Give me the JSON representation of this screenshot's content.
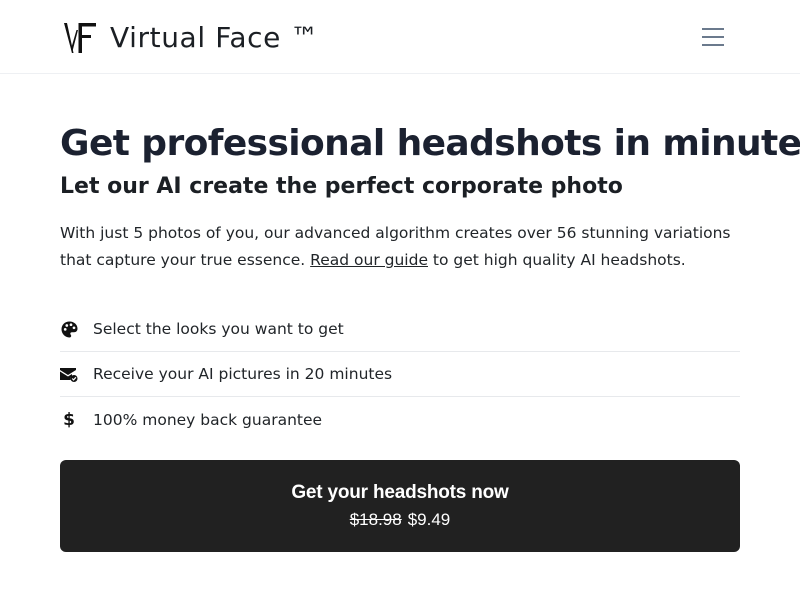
{
  "header": {
    "brand_name": "Virtual Face ™",
    "menu_icon": "hamburger-menu-icon",
    "logo_icon": "vf-logo-icon"
  },
  "main": {
    "headline": "Get professional headshots in minutes",
    "subheadline": "Let our AI create the perfect corporate photo",
    "lead_text_1": "With just 5 photos of you, our advanced algorithm creates over 56 stunning variations that capture your true essence.",
    "guide_link": "Read our guide",
    "lead_text_2": "to get high quality AI headshots.",
    "features": [
      {
        "icon": "palette-icon",
        "label": "Select the looks you want to get"
      },
      {
        "icon": "envelope-check-icon",
        "label": "Receive your AI pictures in 20 minutes"
      },
      {
        "icon": "dollar-icon",
        "label": "100% money back guarantee"
      }
    ]
  },
  "cta": {
    "label": "Get your headshots now",
    "old_price": "$18.98",
    "new_price": "$9.49"
  },
  "colors": {
    "cta_background": "#212121",
    "text": "#212529",
    "menu_icon": "#6b7a8d"
  }
}
